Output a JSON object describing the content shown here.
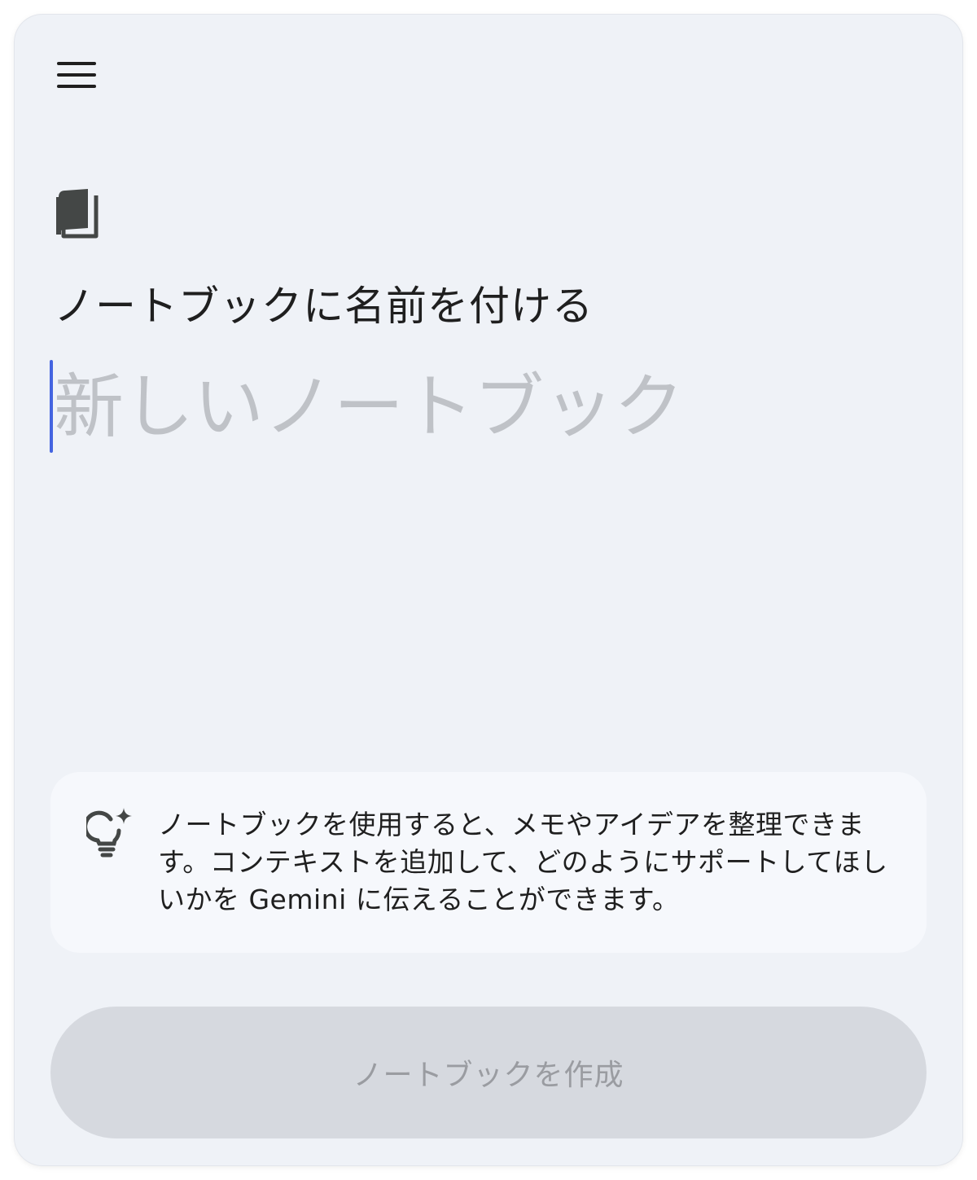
{
  "header": {
    "menu_icon": "hamburger-menu-icon"
  },
  "notebook": {
    "icon": "book-icon",
    "title": "ノートブックに名前を付ける",
    "name_placeholder": "新しいノートブック",
    "name_value": ""
  },
  "info": {
    "icon": "lightbulb-sparkle-icon",
    "text": "ノートブックを使用すると、メモやアイデアを整理できます。コンテキストを追加して、どのようにサポートしてほしいかを Gemini に伝えることができます。"
  },
  "actions": {
    "create_label": "ノートブックを作成",
    "create_enabled": false
  },
  "colors": {
    "background": "#eff2f7",
    "card": "#f6f8fc",
    "caret": "#4464e0",
    "button_disabled": "#d6d9df",
    "button_text_disabled": "#9a9ca1",
    "placeholder": "#bfc2c7"
  }
}
